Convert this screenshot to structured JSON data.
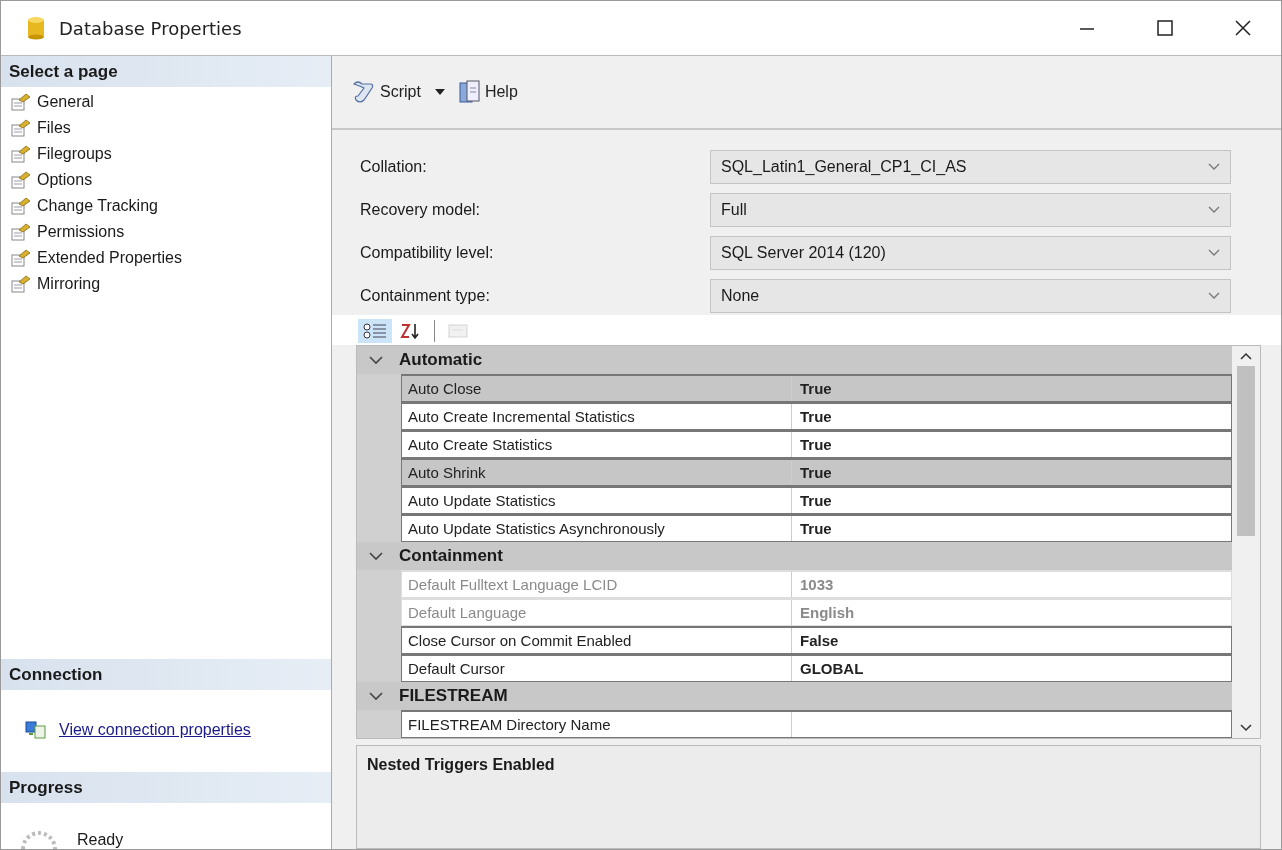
{
  "window": {
    "title": "Database Properties"
  },
  "sidebar": {
    "heading": "Select a page",
    "pages": [
      {
        "label": "General"
      },
      {
        "label": "Files"
      },
      {
        "label": "Filegroups"
      },
      {
        "label": "Options"
      },
      {
        "label": "Change Tracking"
      },
      {
        "label": "Permissions"
      },
      {
        "label": "Extended Properties"
      },
      {
        "label": "Mirroring"
      }
    ]
  },
  "connection": {
    "heading": "Connection",
    "link": "View connection properties"
  },
  "progress": {
    "heading": "Progress",
    "status": "Ready"
  },
  "toolbar": {
    "buttons": [
      {
        "label": "Script",
        "kind": "script"
      },
      {
        "label": "Help",
        "kind": "help"
      }
    ]
  },
  "fields": [
    {
      "label": "Collation:",
      "value": "SQL_Latin1_General_CP1_CI_AS"
    },
    {
      "label": "Recovery model:",
      "value": "Full"
    },
    {
      "label": "Compatibility level:",
      "value": "SQL Server 2014 (120)"
    },
    {
      "label": "Containment type:",
      "value": "None"
    }
  ],
  "grid_toolbar": {
    "buttons": [
      {
        "kind": "categorized",
        "selected": true,
        "disabled": false
      },
      {
        "kind": "alphabetical",
        "selected": false,
        "disabled": false
      },
      {
        "kind": "property-pages",
        "selected": false,
        "disabled": true
      }
    ]
  },
  "grid": {
    "categories": [
      {
        "name": "Automatic",
        "expanded": true,
        "properties": [
          {
            "name": "Auto Close",
            "value": "True",
            "highlighted": true,
            "disabled": false
          },
          {
            "name": "Auto Create Incremental Statistics",
            "value": "True",
            "highlighted": false,
            "disabled": false
          },
          {
            "name": "Auto Create Statistics",
            "value": "True",
            "highlighted": false,
            "disabled": false
          },
          {
            "name": "Auto Shrink",
            "value": "True",
            "highlighted": true,
            "disabled": false
          },
          {
            "name": "Auto Update Statistics",
            "value": "True",
            "highlighted": false,
            "disabled": false
          },
          {
            "name": "Auto Update Statistics Asynchronously",
            "value": "True",
            "highlighted": false,
            "disabled": false
          }
        ]
      },
      {
        "name": "Containment",
        "expanded": true,
        "properties": [
          {
            "name": "Default Fulltext Language LCID",
            "value": "1033",
            "highlighted": false,
            "disabled": true
          },
          {
            "name": "Default Language",
            "value": "English",
            "highlighted": false,
            "disabled": true
          },
          {
            "name": "Close Cursor on Commit Enabled",
            "value": "False",
            "highlighted": false,
            "disabled": false
          },
          {
            "name": "Default Cursor",
            "value": "GLOBAL",
            "highlighted": false,
            "disabled": false
          }
        ]
      },
      {
        "name": "FILESTREAM",
        "expanded": true,
        "properties": [
          {
            "name": "FILESTREAM Directory Name",
            "highlighted": false,
            "disabled": false
          }
        ]
      }
    ]
  },
  "description": {
    "title": "Nested Triggers Enabled"
  }
}
